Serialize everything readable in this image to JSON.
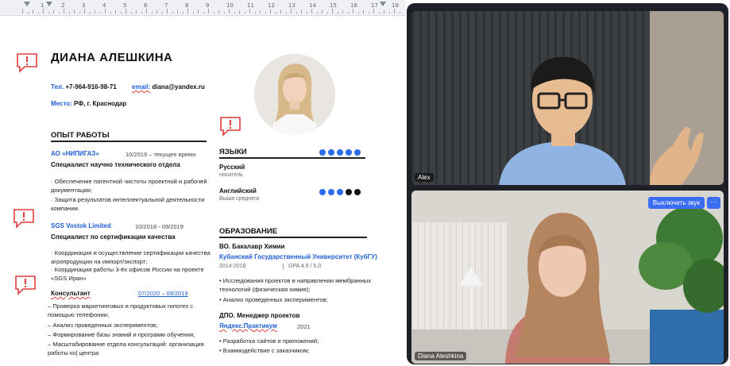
{
  "document": {
    "name": "ДИАНА АЛЕШКИНА",
    "contacts": {
      "phone_label": "Тел.",
      "phone": " +7-964-916-98-71",
      "email_label": "email:",
      "email": " diana@yandex.ru",
      "place_label": "Место:",
      "place": " РФ, г. Краснодар"
    },
    "experience": {
      "title": "ОПЫТ РАБОТЫ",
      "jobs": [
        {
          "company": "АО «НИПИГАЗ»",
          "dates": "10/2019 – текущее время",
          "role": "Специалист научно технического отдела",
          "bullets": [
            "Обеспечение патентной чистоты проектной и рабочей документации;",
            "Защита результатов интеллектуальной деятельности компании."
          ]
        },
        {
          "company": "SGS Vostok Limited",
          "dates": "10/2018 - 09/2019",
          "role": "Специалист по сертификации качества",
          "bullets": [
            "Координация и осуществление сертификации качества агропродукции на импорт/экспорт;",
            "Координация работы 3-ёх офисов России на проекте «SGS Иран»"
          ]
        },
        {
          "company": "",
          "dates": "07/2020 – 09/2019",
          "role": "Консультант",
          "bullets": [
            "– Проверка маркетинговых и продуктовых гипотез с помощью телефонии;",
            "– Анализ проведенных экспериментов;",
            "– Формирование базы знаний и программ обучения;",
            "– Масштабирование отдела консультаций: организация работы ко| центра"
          ]
        }
      ]
    },
    "languages": {
      "title": "ЯЗЫКИ",
      "items": [
        {
          "name": "Русский",
          "level": "носитель",
          "score": 5
        },
        {
          "name": "Английский",
          "level": "Выше среднего",
          "score": 3
        }
      ]
    },
    "education": {
      "title": "ОБРАЗОВАНИЕ",
      "degree": "ВО. Бакалавр Химии",
      "university": "Кубанский Государственный Университет (КубГУ)",
      "years": "2014-2018",
      "gpa": "GPA  4.9 / 5.0",
      "bullets": [
        "Исследования проектов в направлении мембранных технологий (физическая химия);",
        "Анализ проведенных экспериментов;"
      ],
      "dpo_title": "ДПО. Менеджер проектов",
      "dpo_school": "Яндекс.Практикум",
      "dpo_year": "2021",
      "dpo_bullets": [
        "Разработка сайтов и приложений;",
        "Взаимодействие с заказчиком;"
      ]
    },
    "ruler_numbers": [
      "1",
      "2",
      "3",
      "4",
      "5",
      "6",
      "7",
      "8",
      "9",
      "10",
      "11",
      "12",
      "13",
      "14",
      "15",
      "16",
      "17",
      "18"
    ]
  },
  "call": {
    "participant1": "Alex",
    "participant2": "Diana Aleshkina",
    "mute_button": "Выключить звук",
    "more_button": "···"
  },
  "colors": {
    "accent_blue": "#1f5fd6",
    "dot_filled": "#2a6df0",
    "dot_black": "#111111",
    "comment_red": "#e23b3b"
  }
}
